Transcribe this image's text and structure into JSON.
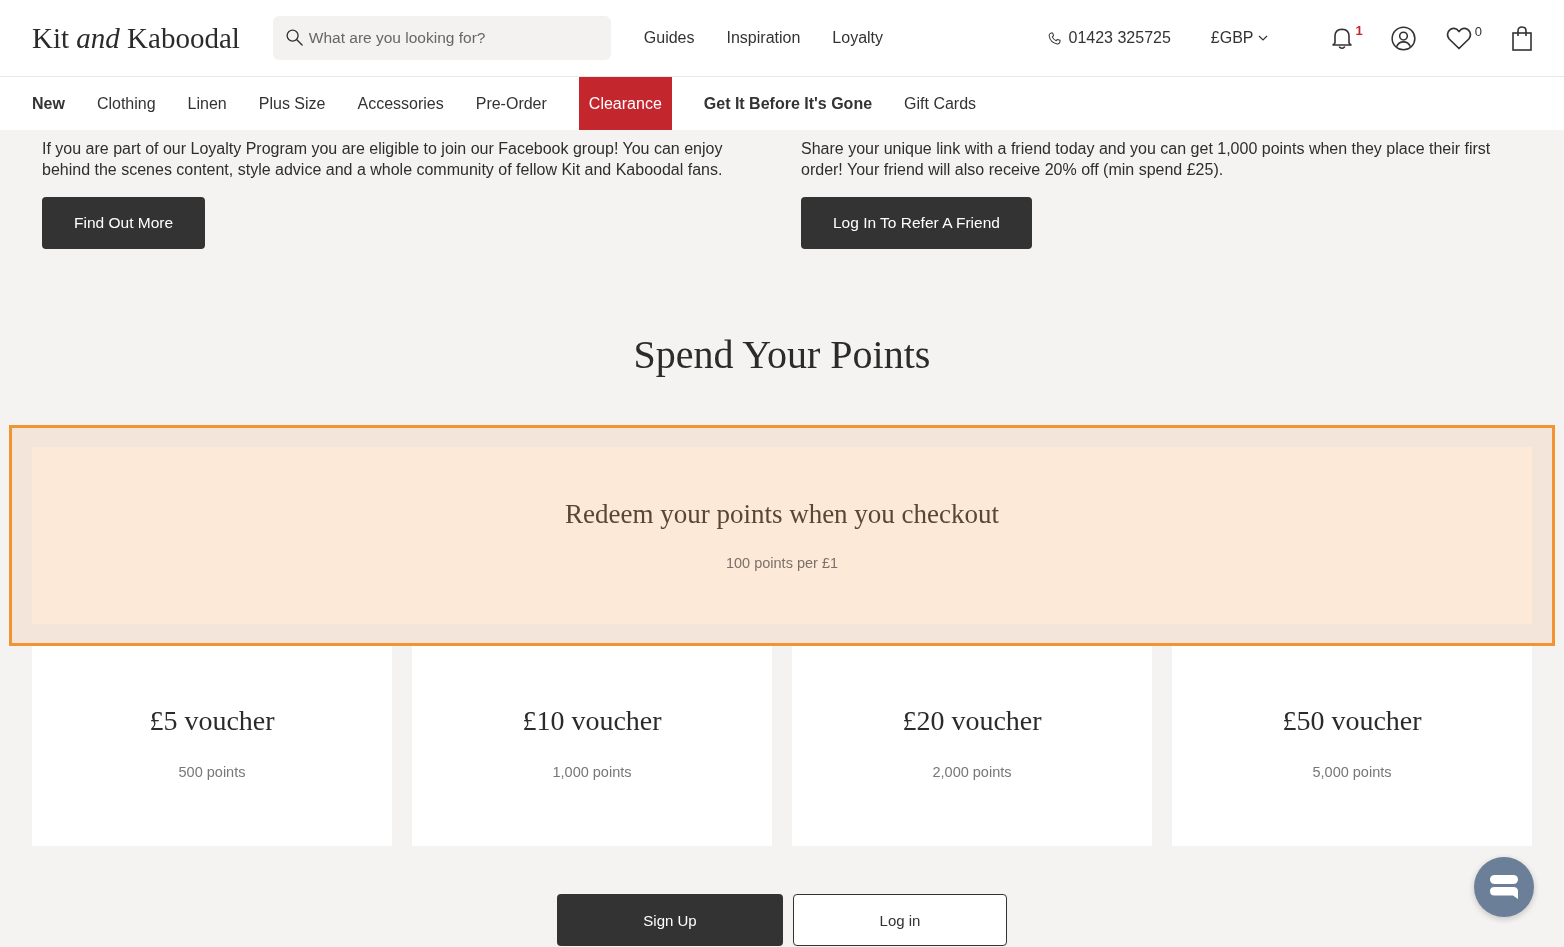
{
  "header": {
    "logo": "Kit *and* Kaboodal",
    "search": {
      "placeholder": "What are you looking for?"
    },
    "links": [
      "Guides",
      "Inspiration",
      "Loyalty"
    ],
    "phone": "01423 325725",
    "currency": "£GBP",
    "notifications_count": "1",
    "wishlist_count": "0"
  },
  "categories": [
    {
      "label": "New",
      "kind": "bold"
    },
    {
      "label": "Clothing",
      "kind": "plain"
    },
    {
      "label": "Linen",
      "kind": "plain"
    },
    {
      "label": "Plus Size",
      "kind": "plain"
    },
    {
      "label": "Accessories",
      "kind": "plain"
    },
    {
      "label": "Pre-Order",
      "kind": "plain"
    },
    {
      "label": "Clearance",
      "kind": "sale"
    },
    {
      "label": "Get It Before It's Gone",
      "kind": "bold"
    },
    {
      "label": "Gift Cards",
      "kind": "plain"
    }
  ],
  "promos": [
    {
      "text": "If you are part of our Loyalty Program you are eligible to join our Facebook group! You can enjoy behind the scenes content, style advice and a whole community of fellow Kit and Kaboodal fans.",
      "button": "Find Out More"
    },
    {
      "text": "Share your unique link with a friend today and you can get 1,000 points when they place their first order! Your friend will also receive 20% off (min spend £25).",
      "button": "Log In To Refer A Friend"
    }
  ],
  "section_title": "Spend Your Points",
  "redeem_banner": {
    "title": "Redeem your points when you checkout",
    "subtitle": "100 points per £1",
    "highlighted": true
  },
  "vouchers": [
    {
      "title": "£5 voucher",
      "points": "500 points"
    },
    {
      "title": "£10 voucher",
      "points": "1,000 points"
    },
    {
      "title": "£20 voucher",
      "points": "2,000 points"
    },
    {
      "title": "£50 voucher",
      "points": "5,000 points"
    }
  ],
  "actions": [
    {
      "label": "Sign Up",
      "kind": "primary"
    },
    {
      "label": "Log in",
      "kind": "secondary"
    }
  ]
}
